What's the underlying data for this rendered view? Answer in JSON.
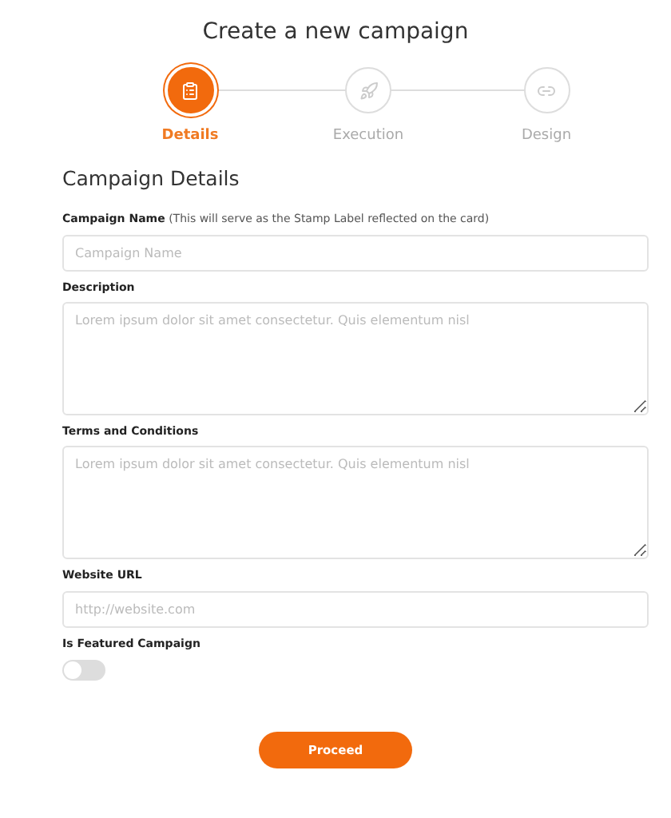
{
  "title": "Create a new campaign",
  "steps": [
    {
      "label": "Details",
      "selected": true
    },
    {
      "label": "Execution",
      "selected": false
    },
    {
      "label": "Design",
      "selected": false
    }
  ],
  "section_title": "Campaign Details",
  "fields": [
    {
      "kind": "input",
      "label": "**Campaign Name** (This will serve as the Stamp Label reflected on the card)",
      "placeholder": "Campaign Name"
    },
    {
      "kind": "textarea",
      "label": "Description",
      "placeholder": "Lorem ipsum dolor sit amet consectetur. Quis elementum nisl"
    },
    {
      "kind": "textarea",
      "label": "Terms and Conditions",
      "placeholder": "Lorem ipsum dolor sit amet consectetur. Quis elementum nisl"
    },
    {
      "kind": "input",
      "label": "Website URL",
      "placeholder": "http://website.com"
    },
    {
      "kind": "toggle",
      "label": "Is Featured Campaign",
      "on": false
    }
  ],
  "submit": "Proceed"
}
